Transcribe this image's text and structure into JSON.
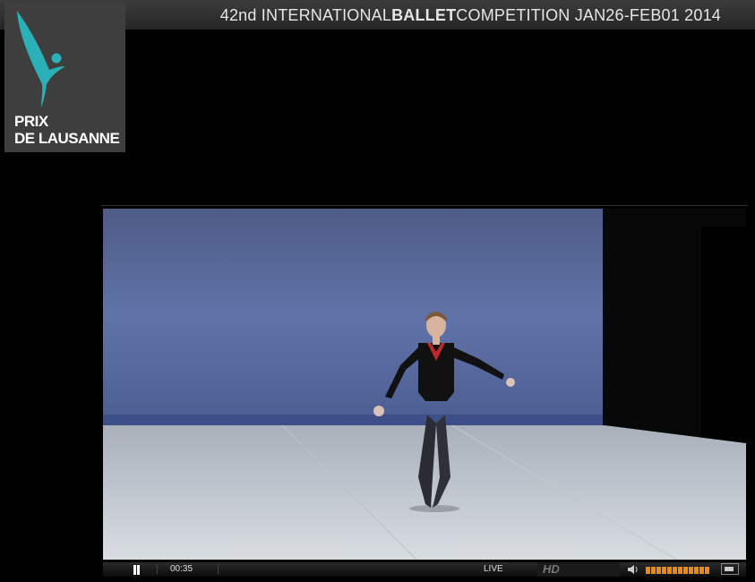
{
  "header": {
    "title_part1": "42nd INTERNATIONAL",
    "title_bold1": "BALLET",
    "title_part2": "COMPETITION JAN26-FEB01 2014"
  },
  "logo": {
    "line1": "PRIX",
    "line2": "DE LAUSANNE",
    "icon": "dancer-logo-icon",
    "color": "#2ab0b8"
  },
  "player": {
    "elapsed": "00:35",
    "live_label": "LIVE",
    "hd_label": "HD",
    "volume_level": 1.0,
    "accent": "#f08a0c",
    "icons": [
      "pause-icon",
      "speaker-icon",
      "fullscreen-icon"
    ]
  }
}
